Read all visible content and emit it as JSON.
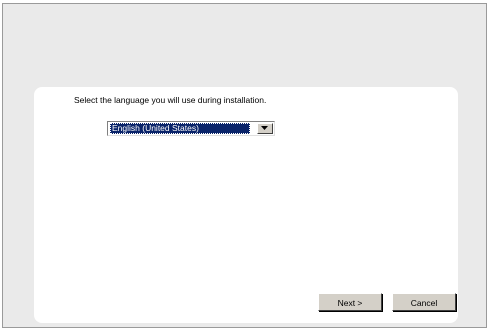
{
  "installer": {
    "instruction": "Select the language you will use during installation.",
    "language_select": {
      "selected": "English (United States)"
    },
    "buttons": {
      "next": {
        "label": "Next >"
      },
      "cancel": {
        "label": "Cancel"
      }
    }
  }
}
